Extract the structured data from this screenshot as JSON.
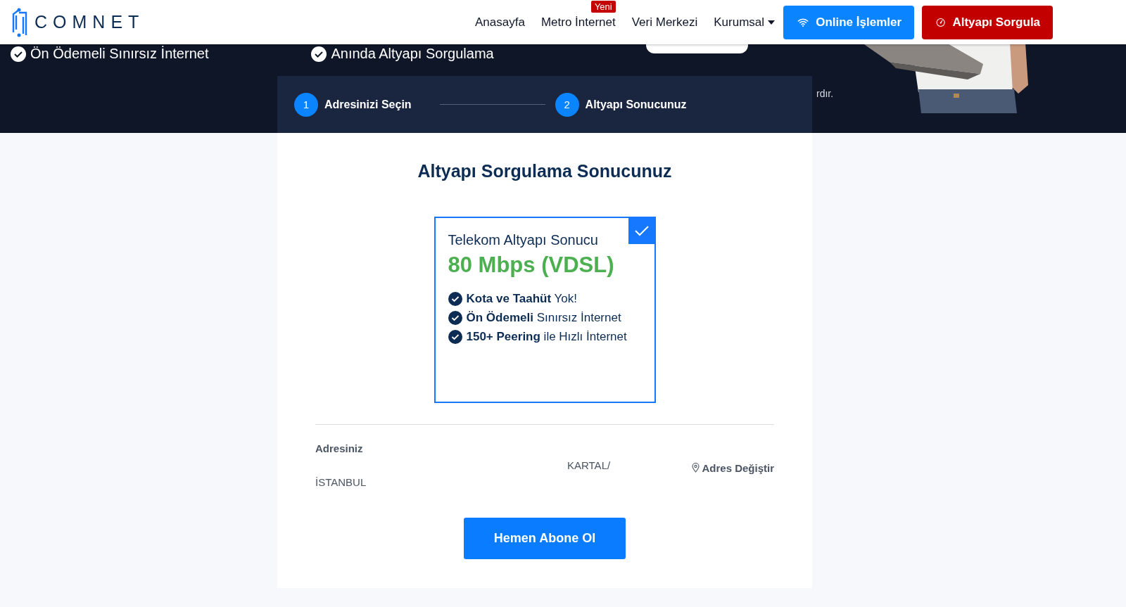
{
  "header": {
    "logo": "COMNET",
    "nav": [
      {
        "label": "Anasayfa",
        "kind": "link"
      },
      {
        "label": "Metro İnternet",
        "kind": "link",
        "badge": "Yeni"
      },
      {
        "label": "Veri Merkezi",
        "kind": "link"
      },
      {
        "label": "Kurumsal",
        "kind": "dropdown"
      }
    ],
    "actions": [
      {
        "label": "Online İşlemler",
        "kind": "wifi"
      },
      {
        "label": "Altyapı Sorgula",
        "kind": "gauge"
      }
    ]
  },
  "hero": {
    "features": [
      "Ön Ödemeli Sınırsız İnternet",
      "Anında Altyapı Sorgulama"
    ],
    "side_text": "rdır.",
    "kind": "picture"
  },
  "steps": [
    {
      "number": "1",
      "label": "Adresinizi Seçin"
    },
    {
      "number": "2",
      "label": "Altyapı Sonucunuz"
    }
  ],
  "result": {
    "title": "Altyapı Sorgulama Sonucunuz",
    "card": {
      "selected": true,
      "provider": "Telekom Altyapı Sonucu",
      "speed": "80 Mbps (VDSL)",
      "features": [
        "**Kota ve Taahüt** Yok!",
        "**Ön Ödemeli** Sınırsız İnternet",
        "**150+ Peering** ile Hızlı İnternet"
      ]
    }
  },
  "address": {
    "label": "Adresiniz",
    "district": "KARTAL/",
    "city": "İSTANBUL",
    "change_link": "Adres Değiştir"
  },
  "subscribe_button": "Hemen Abone Ol"
}
